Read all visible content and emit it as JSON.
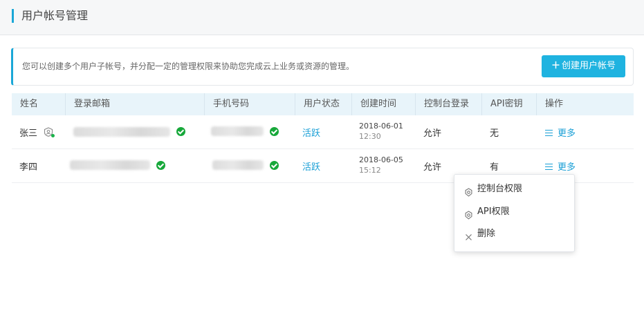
{
  "header": {
    "title": "用户帐号管理"
  },
  "notice": {
    "text": "您可以创建多个用户子帐号，并分配一定的管理权限来协助您完成云上业务或资源的管理。",
    "create_button": "创建用户帐号",
    "create_icon": "plus-icon"
  },
  "table": {
    "columns": [
      "姓名",
      "登录邮箱",
      "手机号码",
      "用户状态",
      "创建时间",
      "控制台登录",
      "API密钥",
      "操作"
    ],
    "rows": [
      {
        "name": "张三",
        "status": "活跃",
        "date": "2018-06-01",
        "time": "12:30",
        "console": "允许",
        "api": "无",
        "action": "更多"
      },
      {
        "name": "李四",
        "status": "活跃",
        "date": "2018-06-05",
        "time": "15:12",
        "console": "允许",
        "api": "有",
        "action": "更多"
      }
    ]
  },
  "dropdown": {
    "items": [
      {
        "label": "控制台权限",
        "icon": "gear-icon"
      },
      {
        "label": "API权限",
        "icon": "gear-icon"
      },
      {
        "label": "删除",
        "icon": "close-icon"
      }
    ]
  },
  "colors": {
    "accent": "#1fb3e0",
    "verified": "#17a83a",
    "link": "#1a9fd6"
  }
}
